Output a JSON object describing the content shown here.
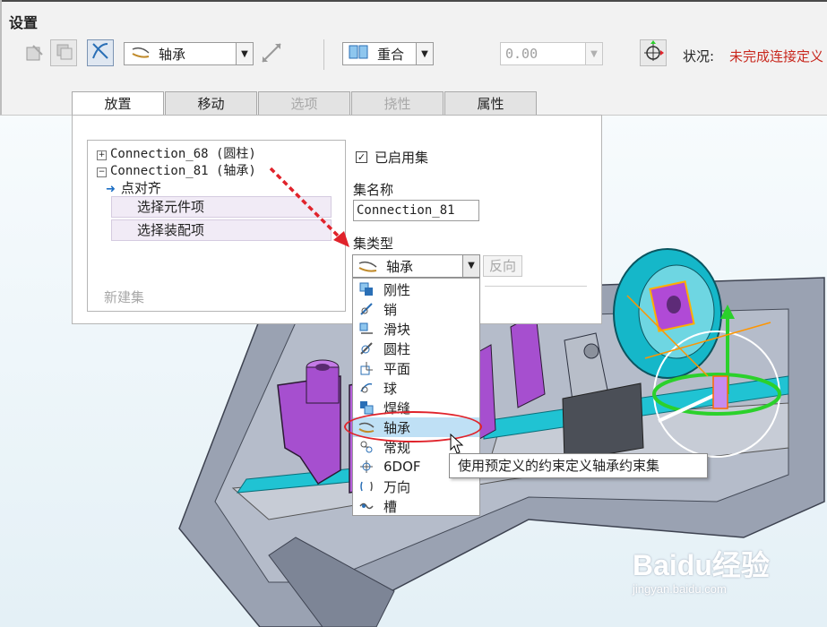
{
  "ribbon": {
    "title": "设置",
    "connection_type": "轴承",
    "constraint_type": "重合",
    "offset_value": "0.00",
    "status_label": "状况:",
    "status_value": "未完成连接定义"
  },
  "tabs": [
    {
      "label": "放置",
      "state": "active"
    },
    {
      "label": "移动",
      "state": "enabled"
    },
    {
      "label": "选项",
      "state": "disabled"
    },
    {
      "label": "挠性",
      "state": "disabled"
    },
    {
      "label": "属性",
      "state": "enabled"
    }
  ],
  "panel": {
    "tree": {
      "items": [
        {
          "expander": "+",
          "label": "Connection_68 (圆柱)"
        },
        {
          "expander": "−",
          "label": "Connection_81 (轴承)"
        }
      ],
      "sub_item": "点对齐",
      "collectors": [
        "选择元件项",
        "选择装配项"
      ],
      "new_set": "新建集"
    },
    "enable_set_label": "已启用集",
    "enable_set_checked": true,
    "set_name_label": "集名称",
    "set_name_value": "Connection_81",
    "set_type_label": "集类型",
    "set_type_value": "轴承",
    "flip_label": "反向"
  },
  "dropdown": {
    "items": [
      "刚性",
      "销",
      "滑块",
      "圆柱",
      "平面",
      "球",
      "焊缝",
      "轴承",
      "常规",
      "6DOF",
      "万向",
      "槽"
    ],
    "selected": "轴承",
    "icons": [
      "rigid-icon",
      "pin-icon",
      "slider-icon",
      "cylinder-icon",
      "planar-icon",
      "ball-icon",
      "weld-icon",
      "bearing-icon",
      "general-icon",
      "6dof-icon",
      "gimbal-icon",
      "slot-icon"
    ]
  },
  "tooltip": "使用预定义的约束定义轴承约束集",
  "watermark": {
    "brand": "Baidu经验",
    "url": "jingyan.baidu.com"
  },
  "colors": {
    "status_red": "#c8281e",
    "highlight_red": "#e0232b",
    "selection_blue": "#bfe0f5",
    "part_purple": "#a23cc4",
    "part_cyan": "#13b6c8"
  }
}
